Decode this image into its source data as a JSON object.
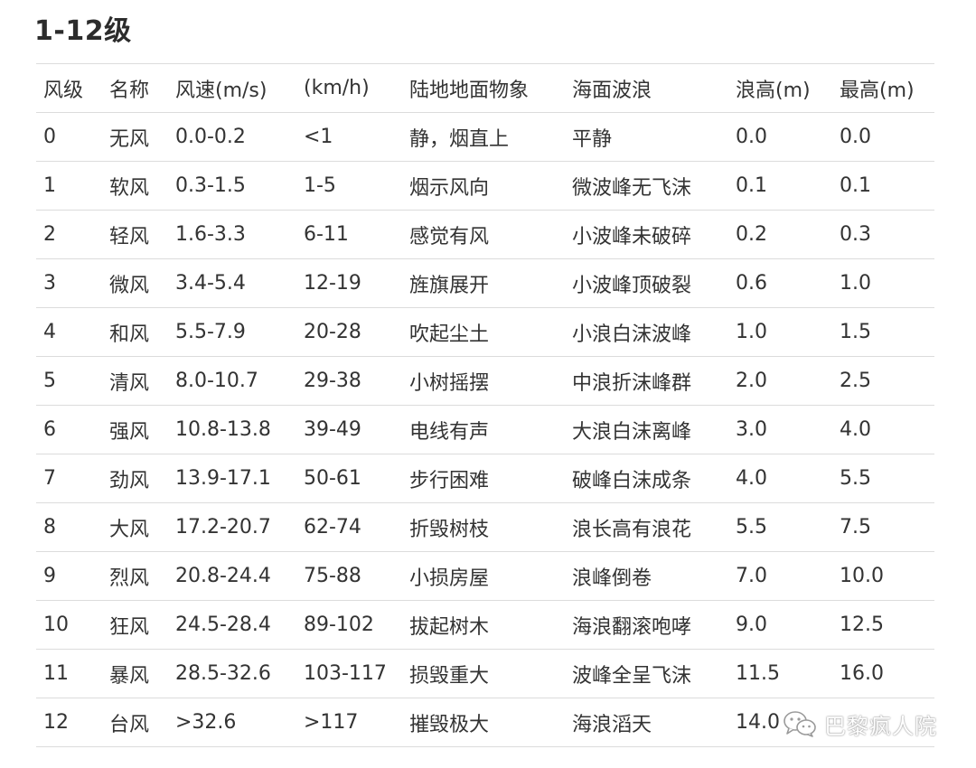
{
  "title": "1-12级",
  "table": {
    "headers": [
      "风级",
      "名称",
      "风速(m/s)",
      "(km/h)",
      "陆地地面物象",
      "海面波浪",
      "浪高(m)",
      "最高(m)"
    ],
    "rows": [
      [
        "0",
        "无风",
        "0.0-0.2",
        "<1",
        "静，烟直上",
        "平静",
        "0.0",
        "0.0"
      ],
      [
        "1",
        "软风",
        "0.3-1.5",
        "1-5",
        "烟示风向",
        "微波峰无飞沫",
        "0.1",
        "0.1"
      ],
      [
        "2",
        "轻风",
        "1.6-3.3",
        "6-11",
        "感觉有风",
        "小波峰未破碎",
        "0.2",
        "0.3"
      ],
      [
        "3",
        "微风",
        "3.4-5.4",
        "12-19",
        "旌旗展开",
        "小波峰顶破裂",
        "0.6",
        "1.0"
      ],
      [
        "4",
        "和风",
        "5.5-7.9",
        "20-28",
        "吹起尘土",
        "小浪白沫波峰",
        "1.0",
        "1.5"
      ],
      [
        "5",
        "清风",
        "8.0-10.7",
        "29-38",
        "小树摇摆",
        "中浪折沫峰群",
        "2.0",
        "2.5"
      ],
      [
        "6",
        "强风",
        "10.8-13.8",
        "39-49",
        "电线有声",
        "大浪白沫离峰",
        "3.0",
        "4.0"
      ],
      [
        "7",
        "劲风",
        "13.9-17.1",
        "50-61",
        "步行困难",
        "破峰白沫成条",
        "4.0",
        "5.5"
      ],
      [
        "8",
        "大风",
        "17.2-20.7",
        "62-74",
        "折毁树枝",
        "浪长高有浪花",
        "5.5",
        "7.5"
      ],
      [
        "9",
        "烈风",
        "20.8-24.4",
        "75-88",
        "小损房屋",
        "浪峰倒卷",
        "7.0",
        "10.0"
      ],
      [
        "10",
        "狂风",
        "24.5-28.4",
        "89-102",
        "拔起树木",
        "海浪翻滚咆哮",
        "9.0",
        "12.5"
      ],
      [
        "11",
        "暴风",
        "28.5-32.6",
        "103-117",
        "损毁重大",
        "波峰全呈飞沫",
        "11.5",
        "16.0"
      ],
      [
        "12",
        "台风",
        ">32.6",
        ">117",
        "摧毁极大",
        "海浪滔天",
        "14.0",
        ""
      ]
    ]
  },
  "watermark": {
    "icon": "wechat-icon",
    "text": "巴黎疯人院"
  }
}
